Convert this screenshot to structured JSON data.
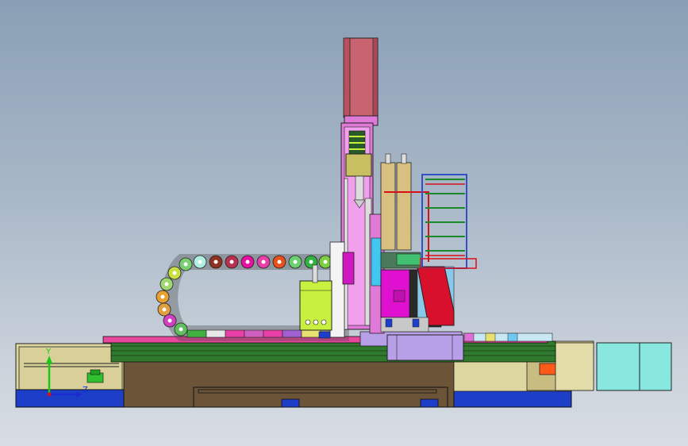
{
  "viewport": {
    "background_top": "#8a9fb5",
    "background_bottom": "#d8dde3"
  },
  "triad": {
    "y_label": "Y",
    "z_label": "Z",
    "y_color": "#19c819",
    "z_color": "#1a2cd0"
  },
  "colors": {
    "base": "#6b5438",
    "frame": "#ddd6a0",
    "blue_foot": "#1c3ec8",
    "motor_head": "#c86470",
    "pink_plate": "#e07ad8",
    "magenta": "#e010d0",
    "drag_chain": "#e8409c",
    "green_rails": "#2f7a2c",
    "cyan_motor": "#88e8e0",
    "lime_cylinder": "#c8f040",
    "red_bracket": "#d8102c",
    "tan_cylinder": "#d8c080",
    "lavender": "#b8a0e8"
  },
  "icons": [
    "coordinate-triad-icon"
  ]
}
